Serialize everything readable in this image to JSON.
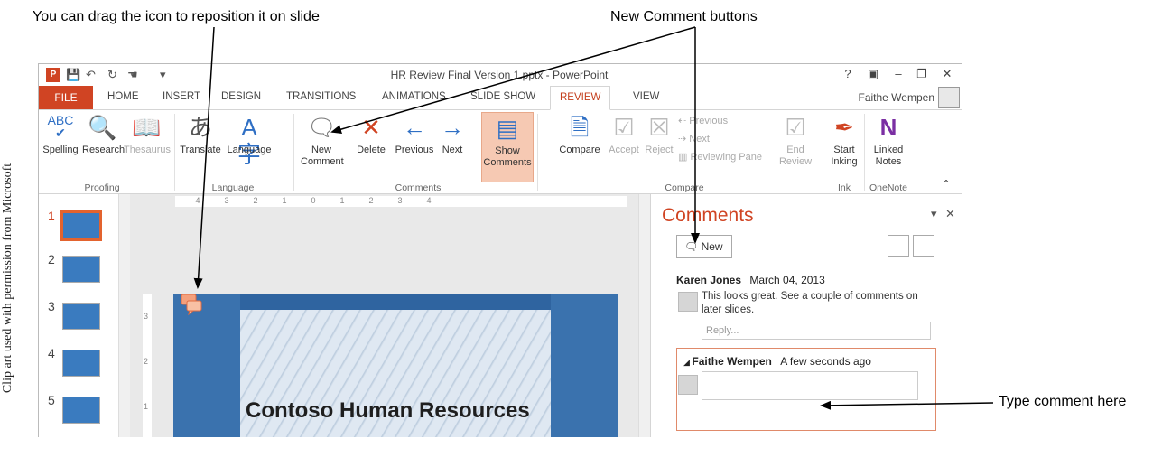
{
  "callouts": {
    "drag_icon": "You can drag the icon to reposition it on slide",
    "new_comment_buttons": "New Comment buttons",
    "type_comment": "Type comment here",
    "credit": "Clip art used with permission from Microsoft"
  },
  "window": {
    "title": "HR Review Final Version 1.pptx - PowerPoint",
    "controls": [
      "?",
      "▣",
      "–",
      "❐",
      "✕"
    ]
  },
  "tabs": {
    "file": "FILE",
    "items": [
      "HOME",
      "INSERT",
      "DESIGN",
      "TRANSITIONS",
      "ANIMATIONS",
      "SLIDE SHOW",
      "REVIEW",
      "VIEW"
    ],
    "active": "REVIEW",
    "user": "Faithe Wempen"
  },
  "ribbon": {
    "proofing": {
      "group": "Proofing",
      "spelling": "Spelling",
      "research": "Research",
      "thesaurus": "Thesaurus"
    },
    "language": {
      "group": "Language",
      "translate": "Translate",
      "language": "Language"
    },
    "comments": {
      "group": "Comments",
      "new": "New",
      "new2": "Comment",
      "delete": "Delete",
      "previous": "Previous",
      "next": "Next",
      "show": "Show",
      "show2": "Comments"
    },
    "compare": {
      "group": "Compare",
      "compare": "Compare",
      "accept": "Accept",
      "reject": "Reject",
      "previous": "Previous",
      "next": "Next",
      "reviewing_pane": "Reviewing Pane",
      "end": "End",
      "end2": "Review"
    },
    "ink": {
      "group": "Ink",
      "start": "Start",
      "start2": "Inking"
    },
    "onenote": {
      "group": "OneNote",
      "linked": "Linked",
      "linked2": "Notes"
    }
  },
  "thumbnails": [
    "1",
    "2",
    "3",
    "4",
    "5"
  ],
  "slide": {
    "title": "Contoso Human Resources",
    "ruler": "·  ·  · 4 ·  ·  · 3 ·  ·  · 2 ·  ·  · 1 ·  ·  · 0 ·  ·  · 1 ·  ·  · 2 ·  ·  · 3 ·  ·  · 4 ·  ·  ·",
    "vruler": [
      "3",
      "2",
      "1"
    ]
  },
  "comments_pane": {
    "title": "Comments",
    "new_button": "New",
    "comment1": {
      "author": "Karen Jones",
      "date": "March 04, 2013",
      "text": "This looks great. See a couple of comments on later slides.",
      "reply_placeholder": "Reply..."
    },
    "comment2": {
      "author": "Faithe Wempen",
      "date": "A few seconds ago"
    }
  },
  "colors": {
    "accent": "#d04423",
    "slide_blue": "#3a72ae",
    "show_comments_bg": "#f6c9b3"
  }
}
